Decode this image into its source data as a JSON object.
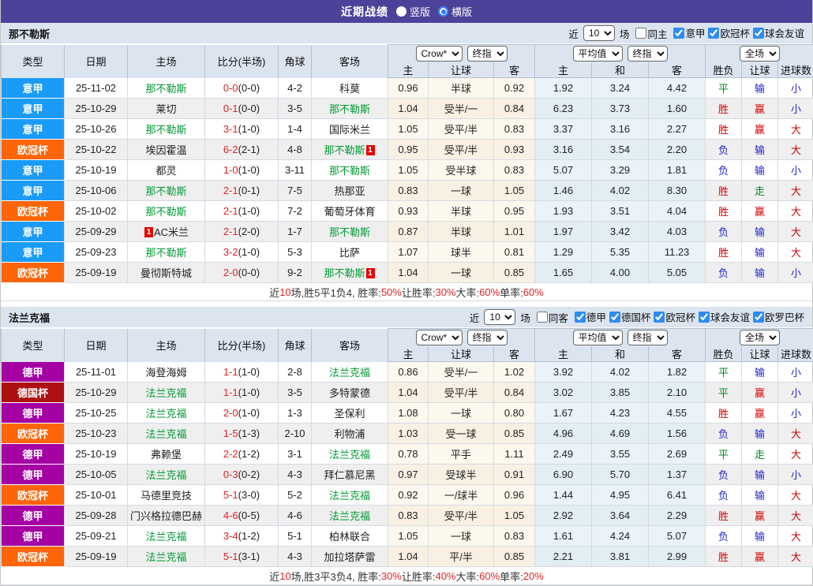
{
  "topbar": {
    "title": "近期战绩",
    "radio_vertical": "竖版",
    "radio_horizontal": "横版"
  },
  "header": {
    "col_type": "类型",
    "col_date": "日期",
    "col_home": "主场",
    "col_score": "比分(半场)",
    "col_corner": "角球",
    "col_away": "客场",
    "sel_crow": "Crow*",
    "sel_final1": "终指",
    "sel_avg": "平均值",
    "sel_final2": "终指",
    "sel_full": "全场",
    "sub_home": "主",
    "sub_handicap": "让球",
    "sub_away": "客",
    "sub_home2": "主",
    "sub_draw": "和",
    "sub_away2": "客",
    "sub_result": "胜负",
    "sub_handicap2": "让球",
    "sub_goals": "进球数"
  },
  "league_colors": {
    "意甲": "#1b9bf8",
    "欧冠杯": "#fd6506",
    "德甲": "#a400a4",
    "德国杯": "#ad1010"
  },
  "sections": [
    {
      "team": "那不勒斯",
      "filters": {
        "near": "近",
        "count": "10",
        "games": "场",
        "same": "同主",
        "leagues": [
          "意甲",
          "欧冠杯",
          "球会友谊"
        ]
      },
      "rows": [
        {
          "lg": "意甲",
          "date": "25-11-02",
          "home": "那不勒斯",
          "hg": 1,
          "hb": "",
          "score": "0-0",
          "half": "(0-0)",
          "cor": "4-2",
          "away": "科莫",
          "ag": 0,
          "ab": "",
          "od": [
            "0.96",
            "半球",
            "0.92"
          ],
          "av": [
            "1.92",
            "3.24",
            "4.42"
          ],
          "rs": [
            [
              "平",
              "g"
            ],
            [
              "输",
              "b"
            ],
            [
              "小",
              "b"
            ]
          ]
        },
        {
          "lg": "意甲",
          "date": "25-10-29",
          "home": "莱切",
          "hg": 0,
          "hb": "",
          "score": "0-1",
          "half": "(0-0)",
          "cor": "3-5",
          "away": "那不勒斯",
          "ag": 1,
          "ab": "",
          "od": [
            "1.04",
            "受半/一",
            "0.84"
          ],
          "av": [
            "6.23",
            "3.73",
            "1.60"
          ],
          "rs": [
            [
              "胜",
              "r"
            ],
            [
              "赢",
              "r"
            ],
            [
              "小",
              "b"
            ]
          ]
        },
        {
          "lg": "意甲",
          "date": "25-10-26",
          "home": "那不勒斯",
          "hg": 1,
          "hb": "",
          "score": "3-1",
          "half": "(1-0)",
          "cor": "1-4",
          "away": "国际米兰",
          "ag": 0,
          "ab": "",
          "od": [
            "1.05",
            "受平/半",
            "0.83"
          ],
          "av": [
            "3.37",
            "3.16",
            "2.27"
          ],
          "rs": [
            [
              "胜",
              "r"
            ],
            [
              "赢",
              "r"
            ],
            [
              "大",
              "r"
            ]
          ]
        },
        {
          "lg": "欧冠杯",
          "date": "25-10-22",
          "home": "埃因霍温",
          "hg": 0,
          "hb": "",
          "score": "6-2",
          "half": "(2-1)",
          "cor": "4-8",
          "away": "那不勒斯",
          "ag": 1,
          "ab": "a",
          "od": [
            "0.95",
            "受平/半",
            "0.93"
          ],
          "av": [
            "3.16",
            "3.54",
            "2.20"
          ],
          "rs": [
            [
              "负",
              "b"
            ],
            [
              "输",
              "b"
            ],
            [
              "大",
              "r"
            ]
          ]
        },
        {
          "lg": "意甲",
          "date": "25-10-19",
          "home": "都灵",
          "hg": 0,
          "hb": "",
          "score": "1-0",
          "half": "(1-0)",
          "cor": "3-11",
          "away": "那不勒斯",
          "ag": 1,
          "ab": "",
          "od": [
            "1.05",
            "受半球",
            "0.83"
          ],
          "av": [
            "5.07",
            "3.29",
            "1.81"
          ],
          "rs": [
            [
              "负",
              "b"
            ],
            [
              "输",
              "b"
            ],
            [
              "小",
              "b"
            ]
          ]
        },
        {
          "lg": "意甲",
          "date": "25-10-06",
          "home": "那不勒斯",
          "hg": 1,
          "hb": "",
          "score": "2-1",
          "half": "(0-1)",
          "cor": "7-5",
          "away": "热那亚",
          "ag": 0,
          "ab": "",
          "od": [
            "0.83",
            "一球",
            "1.05"
          ],
          "av": [
            "1.46",
            "4.02",
            "8.30"
          ],
          "rs": [
            [
              "胜",
              "r"
            ],
            [
              "走",
              "g"
            ],
            [
              "大",
              "r"
            ]
          ]
        },
        {
          "lg": "欧冠杯",
          "date": "25-10-02",
          "home": "那不勒斯",
          "hg": 1,
          "hb": "",
          "score": "2-1",
          "half": "(1-0)",
          "cor": "7-2",
          "away": "葡萄牙体育",
          "ag": 0,
          "ab": "",
          "od": [
            "0.93",
            "半球",
            "0.95"
          ],
          "av": [
            "1.93",
            "3.51",
            "4.04"
          ],
          "rs": [
            [
              "胜",
              "r"
            ],
            [
              "赢",
              "r"
            ],
            [
              "大",
              "r"
            ]
          ]
        },
        {
          "lg": "意甲",
          "date": "25-09-29",
          "home": "AC米兰",
          "hg": 0,
          "hb": "b",
          "score": "2-1",
          "half": "(2-0)",
          "cor": "1-7",
          "away": "那不勒斯",
          "ag": 1,
          "ab": "",
          "od": [
            "0.87",
            "半球",
            "1.01"
          ],
          "av": [
            "1.97",
            "3.42",
            "4.03"
          ],
          "rs": [
            [
              "负",
              "b"
            ],
            [
              "输",
              "b"
            ],
            [
              "大",
              "r"
            ]
          ]
        },
        {
          "lg": "意甲",
          "date": "25-09-23",
          "home": "那不勒斯",
          "hg": 1,
          "hb": "",
          "score": "3-2",
          "half": "(1-0)",
          "cor": "5-3",
          "away": "比萨",
          "ag": 0,
          "ab": "",
          "od": [
            "1.07",
            "球半",
            "0.81"
          ],
          "av": [
            "1.29",
            "5.35",
            "11.23"
          ],
          "rs": [
            [
              "胜",
              "r"
            ],
            [
              "输",
              "b"
            ],
            [
              "大",
              "r"
            ]
          ]
        },
        {
          "lg": "欧冠杯",
          "date": "25-09-19",
          "home": "曼彻斯特城",
          "hg": 0,
          "hb": "",
          "score": "2-0",
          "half": "(0-0)",
          "cor": "9-2",
          "away": "那不勒斯",
          "ag": 1,
          "ab": "a",
          "od": [
            "1.04",
            "一球",
            "0.85"
          ],
          "av": [
            "1.65",
            "4.00",
            "5.05"
          ],
          "rs": [
            [
              "负",
              "b"
            ],
            [
              "输",
              "b"
            ],
            [
              "小",
              "b"
            ]
          ]
        }
      ],
      "summary": [
        [
          "近",
          0
        ],
        [
          "10",
          1
        ],
        [
          "场,胜5平1负4, 胜率:",
          0
        ],
        [
          "50%",
          1
        ],
        [
          " 让胜率:",
          0
        ],
        [
          "30%",
          1
        ],
        [
          " 大率:",
          0
        ],
        [
          "60%",
          1
        ],
        [
          " 单率:",
          0
        ],
        [
          "60%",
          1
        ]
      ]
    },
    {
      "team": "法兰克福",
      "filters": {
        "near": "近",
        "count": "10",
        "games": "场",
        "same": "同客",
        "leagues": [
          "德甲",
          "德国杯",
          "欧冠杯",
          "球会友谊",
          "欧罗巴杯"
        ]
      },
      "rows": [
        {
          "lg": "德甲",
          "date": "25-11-01",
          "home": "海登海姆",
          "hg": 0,
          "hb": "",
          "score": "1-1",
          "half": "(1-0)",
          "cor": "2-8",
          "away": "法兰克福",
          "ag": 1,
          "ab": "",
          "od": [
            "0.86",
            "受半/一",
            "1.02"
          ],
          "av": [
            "3.92",
            "4.02",
            "1.82"
          ],
          "rs": [
            [
              "平",
              "g"
            ],
            [
              "输",
              "b"
            ],
            [
              "小",
              "b"
            ]
          ]
        },
        {
          "lg": "德国杯",
          "date": "25-10-29",
          "home": "法兰克福",
          "hg": 1,
          "hb": "",
          "score": "1-1",
          "half": "(1-0)",
          "cor": "3-5",
          "away": "多特蒙德",
          "ag": 0,
          "ab": "",
          "od": [
            "1.04",
            "受平/半",
            "0.84"
          ],
          "av": [
            "3.02",
            "3.85",
            "2.10"
          ],
          "rs": [
            [
              "平",
              "g"
            ],
            [
              "赢",
              "r"
            ],
            [
              "小",
              "b"
            ]
          ]
        },
        {
          "lg": "德甲",
          "date": "25-10-25",
          "home": "法兰克福",
          "hg": 1,
          "hb": "",
          "score": "2-0",
          "half": "(1-0)",
          "cor": "1-3",
          "away": "圣保利",
          "ag": 0,
          "ab": "",
          "od": [
            "1.08",
            "一球",
            "0.80"
          ],
          "av": [
            "1.67",
            "4.23",
            "4.55"
          ],
          "rs": [
            [
              "胜",
              "r"
            ],
            [
              "赢",
              "r"
            ],
            [
              "小",
              "b"
            ]
          ]
        },
        {
          "lg": "欧冠杯",
          "date": "25-10-23",
          "home": "法兰克福",
          "hg": 1,
          "hb": "",
          "score": "1-5",
          "half": "(1-3)",
          "cor": "2-10",
          "away": "利物浦",
          "ag": 0,
          "ab": "",
          "od": [
            "1.03",
            "受一球",
            "0.85"
          ],
          "av": [
            "4.96",
            "4.69",
            "1.56"
          ],
          "rs": [
            [
              "负",
              "b"
            ],
            [
              "输",
              "b"
            ],
            [
              "大",
              "r"
            ]
          ]
        },
        {
          "lg": "德甲",
          "date": "25-10-19",
          "home": "弗赖堡",
          "hg": 0,
          "hb": "",
          "score": "2-2",
          "half": "(1-2)",
          "cor": "3-1",
          "away": "法兰克福",
          "ag": 1,
          "ab": "",
          "od": [
            "0.78",
            "平手",
            "1.11"
          ],
          "av": [
            "2.49",
            "3.55",
            "2.69"
          ],
          "rs": [
            [
              "平",
              "g"
            ],
            [
              "走",
              "g"
            ],
            [
              "大",
              "r"
            ]
          ]
        },
        {
          "lg": "德甲",
          "date": "25-10-05",
          "home": "法兰克福",
          "hg": 1,
          "hb": "",
          "score": "0-3",
          "half": "(0-2)",
          "cor": "4-3",
          "away": "拜仁慕尼黑",
          "ag": 0,
          "ab": "",
          "od": [
            "0.97",
            "受球半",
            "0.91"
          ],
          "av": [
            "6.90",
            "5.70",
            "1.37"
          ],
          "rs": [
            [
              "负",
              "b"
            ],
            [
              "输",
              "b"
            ],
            [
              "小",
              "b"
            ]
          ]
        },
        {
          "lg": "欧冠杯",
          "date": "25-10-01",
          "home": "马德里竞技",
          "hg": 0,
          "hb": "",
          "score": "5-1",
          "half": "(3-0)",
          "cor": "5-2",
          "away": "法兰克福",
          "ag": 1,
          "ab": "",
          "od": [
            "0.92",
            "一/球半",
            "0.96"
          ],
          "av": [
            "1.44",
            "4.95",
            "6.41"
          ],
          "rs": [
            [
              "负",
              "b"
            ],
            [
              "输",
              "b"
            ],
            [
              "大",
              "r"
            ]
          ]
        },
        {
          "lg": "德甲",
          "date": "25-09-28",
          "home": "门兴格拉德巴赫",
          "hg": 0,
          "hb": "",
          "score": "4-6",
          "half": "(0-5)",
          "cor": "4-6",
          "away": "法兰克福",
          "ag": 1,
          "ab": "",
          "od": [
            "0.83",
            "受平/半",
            "1.05"
          ],
          "av": [
            "2.92",
            "3.64",
            "2.29"
          ],
          "rs": [
            [
              "胜",
              "r"
            ],
            [
              "赢",
              "r"
            ],
            [
              "大",
              "r"
            ]
          ]
        },
        {
          "lg": "德甲",
          "date": "25-09-21",
          "home": "法兰克福",
          "hg": 1,
          "hb": "",
          "score": "3-4",
          "half": "(1-2)",
          "cor": "5-1",
          "away": "柏林联合",
          "ag": 0,
          "ab": "",
          "od": [
            "1.05",
            "一球",
            "0.83"
          ],
          "av": [
            "1.61",
            "4.24",
            "5.07"
          ],
          "rs": [
            [
              "负",
              "b"
            ],
            [
              "输",
              "b"
            ],
            [
              "大",
              "r"
            ]
          ]
        },
        {
          "lg": "欧冠杯",
          "date": "25-09-19",
          "home": "法兰克福",
          "hg": 1,
          "hb": "",
          "score": "5-1",
          "half": "(3-1)",
          "cor": "4-3",
          "away": "加拉塔萨雷",
          "ag": 0,
          "ab": "",
          "od": [
            "1.04",
            "平/半",
            "0.85"
          ],
          "av": [
            "2.21",
            "3.81",
            "2.99"
          ],
          "rs": [
            [
              "胜",
              "r"
            ],
            [
              "赢",
              "r"
            ],
            [
              "大",
              "r"
            ]
          ]
        }
      ],
      "summary": [
        [
          "近",
          0
        ],
        [
          "10",
          1
        ],
        [
          "场,胜3平3负4, 胜率:",
          0
        ],
        [
          "30%",
          1
        ],
        [
          " 让胜率:",
          0
        ],
        [
          "40%",
          1
        ],
        [
          " 大率:",
          0
        ],
        [
          "60%",
          1
        ],
        [
          " 单率:",
          0
        ],
        [
          "20%",
          1
        ]
      ]
    }
  ]
}
